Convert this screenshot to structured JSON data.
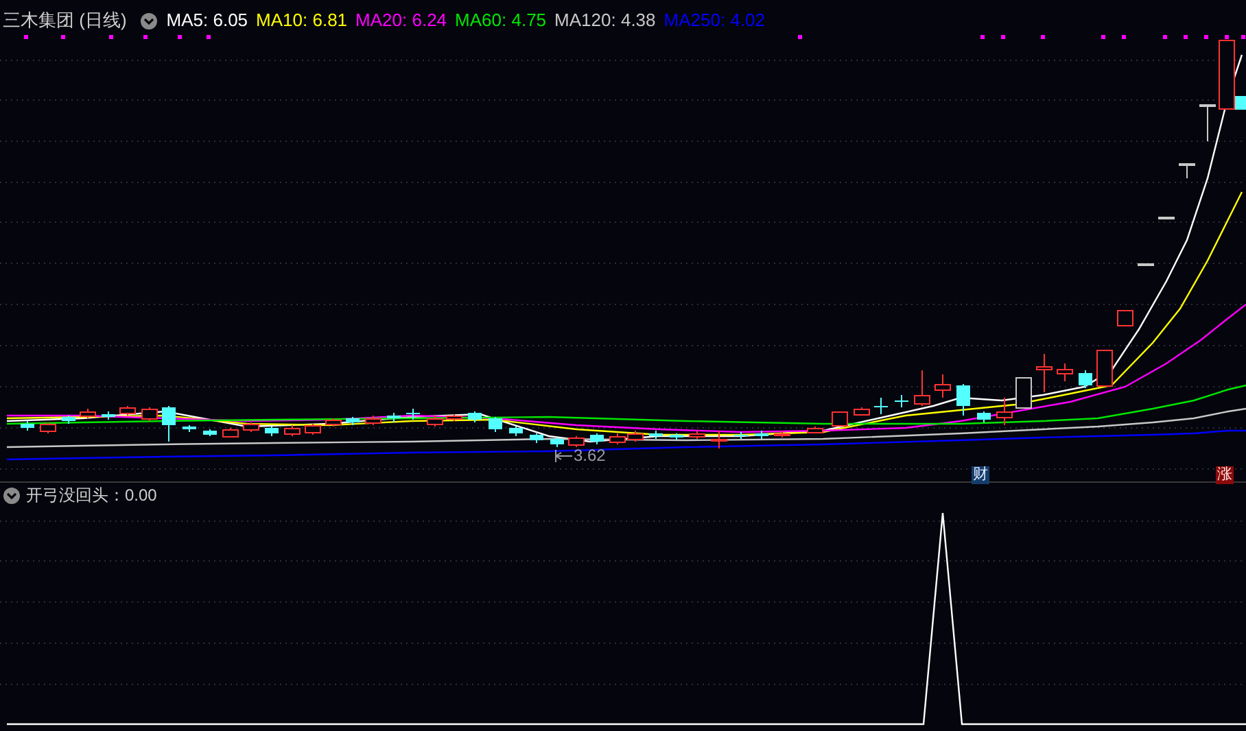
{
  "title": "三木集团 (日线)",
  "ma_legend": [
    {
      "label": "MA5: 6.05",
      "color": "#ffffff"
    },
    {
      "label": "MA10: 6.81",
      "color": "#ffff00"
    },
    {
      "label": "MA20: 6.24",
      "color": "#ff00ff"
    },
    {
      "label": "MA60: 4.75",
      "color": "#00e600"
    },
    {
      "label": "MA120: 4.38",
      "color": "#c8c8c8"
    },
    {
      "label": "MA250: 4.02",
      "color": "#0000ff"
    }
  ],
  "low_marker": "3.62",
  "badges": [
    {
      "text": "财",
      "kind": "finance"
    },
    {
      "text": "涨",
      "kind": "limit-up"
    }
  ],
  "indicator": {
    "label": "开弓没回头：0.00"
  }
}
